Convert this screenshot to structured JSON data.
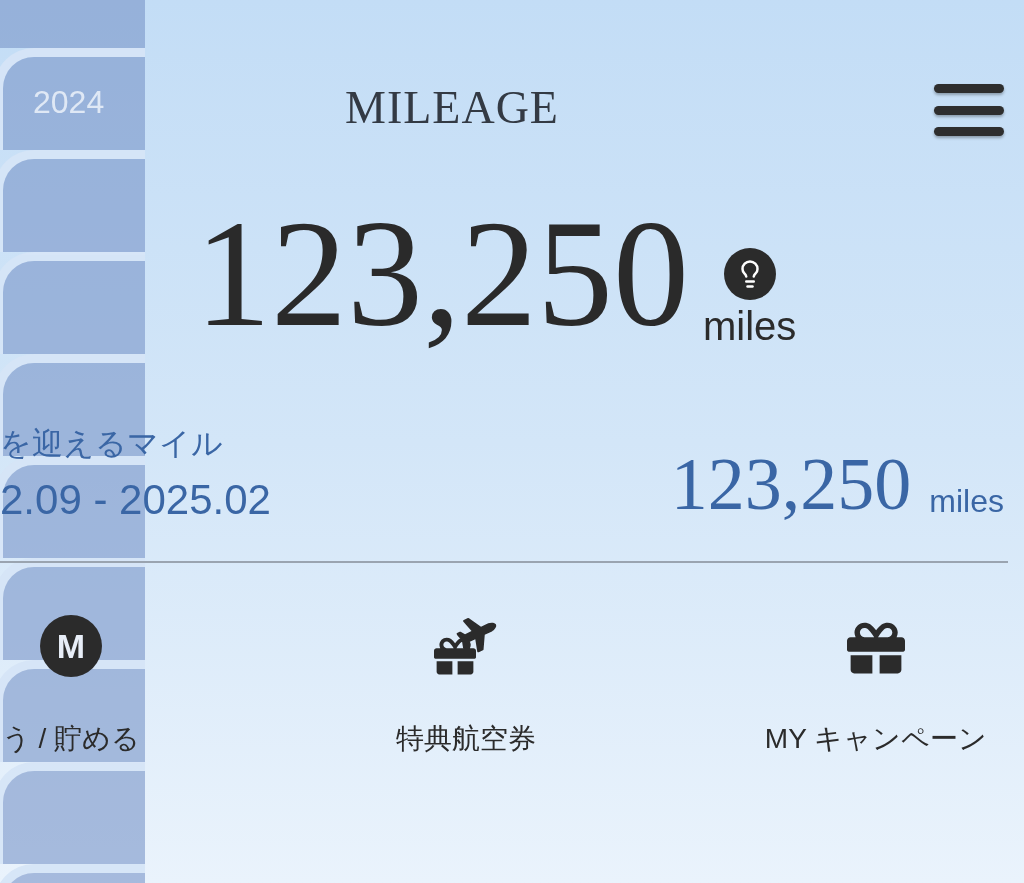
{
  "year_panel": {
    "year": "2024"
  },
  "header": {
    "title": "MILEAGE"
  },
  "total": {
    "value": "123,250",
    "unit": "miles"
  },
  "expiring": {
    "label": "を迎えるマイル",
    "period": "2.09 - 2025.02",
    "value": "123,250",
    "unit": "miles"
  },
  "shortcuts": [
    {
      "kind": "badge",
      "badge": "M",
      "label": "う / 貯める"
    },
    {
      "kind": "award-ticket",
      "label": "特典航空券"
    },
    {
      "kind": "gift",
      "label": "MY キャンペーン"
    }
  ]
}
